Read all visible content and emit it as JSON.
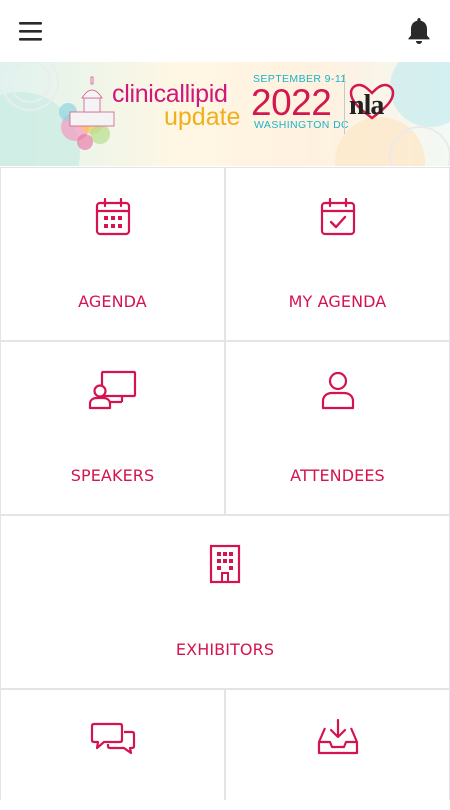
{
  "header": {
    "menu_icon": "hamburger-menu-icon",
    "notifications_icon": "bell-icon"
  },
  "banner": {
    "brand_line1": "clinicallipid",
    "brand_line2": "update",
    "dates": "SEPTEMBER 9-11",
    "year": "2022",
    "location": "WASHINGTON DC",
    "org_logo": "nla",
    "colors": {
      "pink": "#d0177a",
      "gold": "#f0b01c",
      "teal": "#1ab3c8",
      "red": "#d3174f"
    }
  },
  "tiles": [
    {
      "label": "AGENDA",
      "icon": "calendar-grid-icon"
    },
    {
      "label": "MY AGENDA",
      "icon": "calendar-check-icon"
    },
    {
      "label": "SPEAKERS",
      "icon": "presenter-board-icon"
    },
    {
      "label": "ATTENDEES",
      "icon": "person-icon"
    },
    {
      "label": "EXHIBITORS",
      "icon": "building-icon"
    },
    {
      "label": "",
      "icon": "chat-bubbles-icon"
    },
    {
      "label": "",
      "icon": "inbox-download-icon"
    }
  ],
  "accent_color": "#d4134f"
}
